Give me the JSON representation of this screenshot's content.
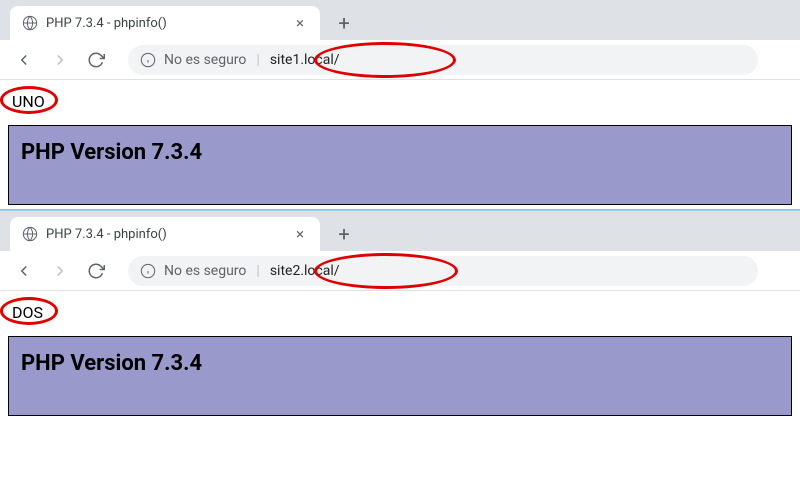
{
  "windows": [
    {
      "tab_title": "PHP 7.3.4 - phpinfo()",
      "security_label": "No es seguro",
      "url": "site1.local/",
      "site_label": "UNO",
      "php_version_heading": "PHP Version 7.3.4"
    },
    {
      "tab_title": "PHP 7.3.4 - phpinfo()",
      "security_label": "No es seguro",
      "url": "site2.local/",
      "site_label": "DOS",
      "php_version_heading": "PHP Version 7.3.4"
    }
  ]
}
